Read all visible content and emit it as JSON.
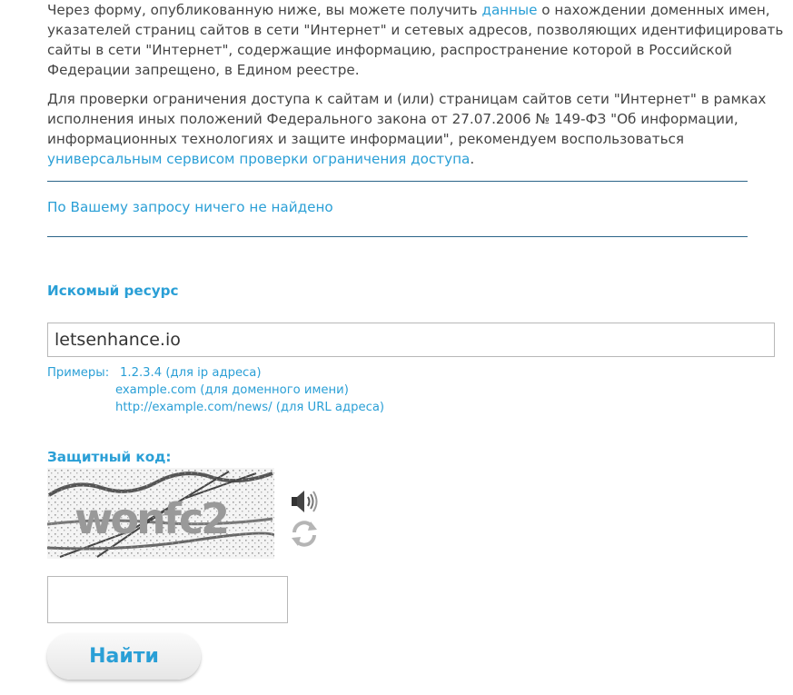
{
  "intro": {
    "p1_before": "Через форму, опубликованную ниже, вы можете получить ",
    "p1_link": "данные",
    "p1_after": " о нахождении доменных имен, указателей страниц сайтов в сети \"Интернет\" и сетевых адресов, позволяющих идентифицировать сайты в сети \"Интернет\", содержащие информацию, распространение которой в Российской Федерации запрещено, в Едином реестре.",
    "p2_before": "Для проверки ограничения доступа к сайтам и (или) страницам сайтов сети \"Интернет\" в рамках исполнения иных положений Федерального закона от 27.07.2006 № 149-ФЗ \"Об информации, информационных технологиях и защите информации\", рекомендуем воспользоваться ",
    "p2_link": "универсальным сервисом проверки ограничения доступа",
    "p2_after": "."
  },
  "result": {
    "message": "По Вашему запросу ничего не найдено"
  },
  "search": {
    "label": "Искомый ресурс",
    "value": "letsenhance.io",
    "examples_label": "Примеры:",
    "examples": [
      "1.2.3.4 (для ip адреса)",
      "example.com (для доменного имени)",
      "http://example.com/news/ (для URL адреса)"
    ]
  },
  "captcha": {
    "label": "Защитный код:",
    "image_text": "wonfc2",
    "audio_icon": "speaker-icon",
    "refresh_icon": "refresh-icon",
    "code_value": ""
  },
  "submit": {
    "label": "Найти"
  },
  "colors": {
    "accent": "#2a9fd6",
    "text": "#444444",
    "rule": "#2b6488"
  }
}
